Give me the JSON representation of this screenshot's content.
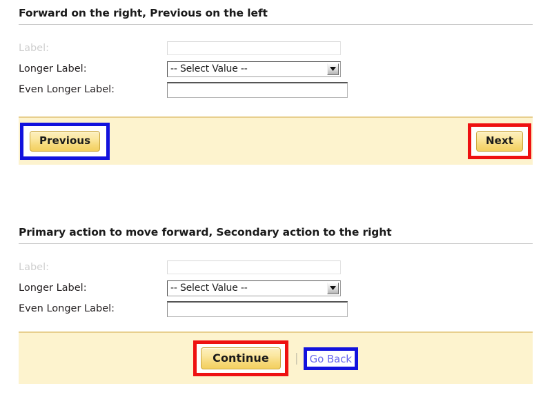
{
  "sections": [
    {
      "heading": "Forward on the right, Previous on the left",
      "form": {
        "rows": [
          {
            "label": "Label:",
            "type": "text",
            "value": "",
            "state": "dim"
          },
          {
            "label": "Longer Label:",
            "type": "select",
            "value": "-- Select Value --"
          },
          {
            "label": "Even Longer Label:",
            "type": "text",
            "value": ""
          }
        ]
      },
      "actions": {
        "layout": "split",
        "previous_label": "Previous",
        "next_label": "Next",
        "previous_highlight": "#1212dd",
        "next_highlight": "#ee1111"
      }
    },
    {
      "heading": "Primary action to move forward, Secondary action to the right",
      "form": {
        "rows": [
          {
            "label": "Label:",
            "type": "text",
            "value": "",
            "state": "dim"
          },
          {
            "label": "Longer Label:",
            "type": "select",
            "value": "-- Select Value --"
          },
          {
            "label": "Even Longer Label:",
            "type": "text",
            "value": ""
          }
        ]
      },
      "actions": {
        "layout": "centered",
        "continue_label": "Continue",
        "separator": "|",
        "go_back_label": "Go Back",
        "continue_highlight": "#ee1111",
        "go_back_highlight": "#1212dd"
      }
    }
  ],
  "colors": {
    "action_bar_background": "#fdf3ce",
    "action_bar_border": "#e8cf8e",
    "button_face": "#f7dc85",
    "link": "#6a6aee",
    "highlight_red": "#ee1111",
    "highlight_blue": "#1212dd"
  }
}
